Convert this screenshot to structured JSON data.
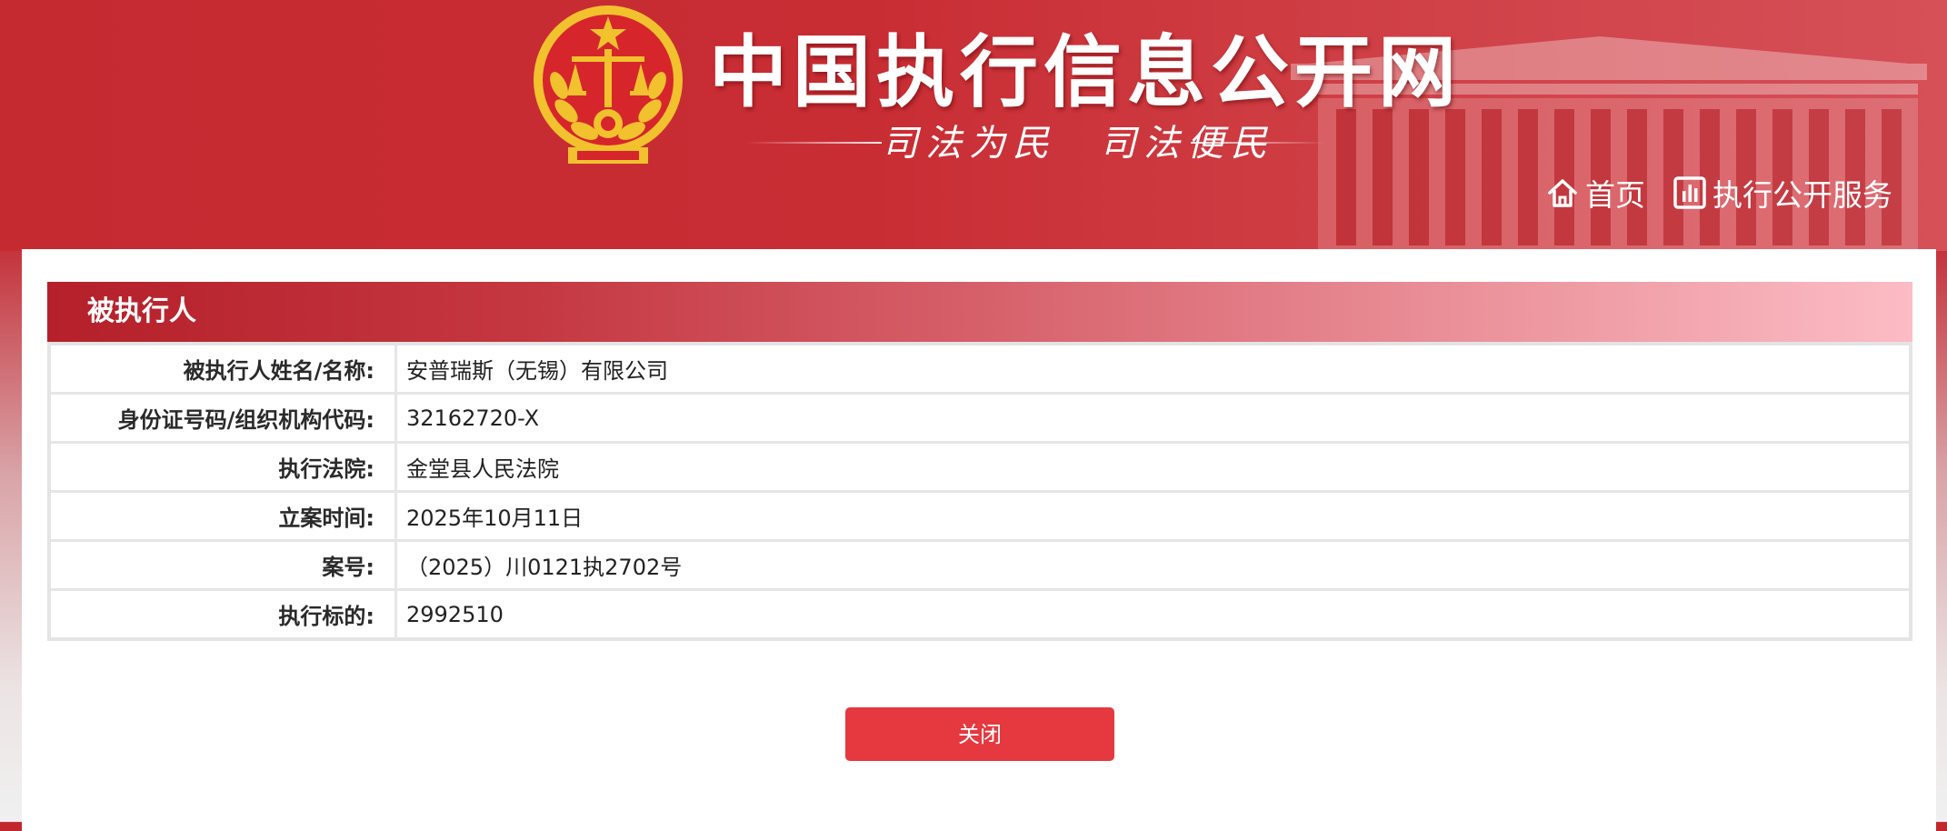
{
  "header": {
    "site_title": "中国执行信息公开网",
    "slogan": "司法为民　司法便民",
    "nav": [
      {
        "icon": "home-icon",
        "label": "首页"
      },
      {
        "icon": "bar-chart-icon",
        "label": "执行公开服务"
      }
    ]
  },
  "section": {
    "title": "被执行人"
  },
  "details": [
    {
      "label": "被执行人姓名/名称:",
      "value": "安普瑞斯（无锡）有限公司"
    },
    {
      "label": "身份证号码/组织机构代码:",
      "value": "32162720-X"
    },
    {
      "label": "执行法院:",
      "value": "金堂县人民法院"
    },
    {
      "label": "立案时间:",
      "value": "2025年10月11日"
    },
    {
      "label": "案号:",
      "value": "（2025）川0121执2702号"
    },
    {
      "label": "执行标的:",
      "value": "2992510"
    }
  ],
  "actions": {
    "close_label": "关闭"
  },
  "colors": {
    "header_red": "#c62a31",
    "button_red": "#e5383f",
    "emblem_gold": "#f2c12e"
  }
}
